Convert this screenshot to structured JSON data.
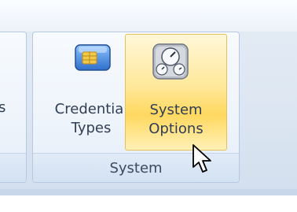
{
  "ribbon": {
    "left_group": {
      "partial_label": "s"
    },
    "system_group": {
      "label": "System",
      "buttons": [
        {
          "line1": "Credential",
          "line2": "Types",
          "icon": "credential-card-icon"
        },
        {
          "line1": "System",
          "line2": "Options",
          "icon": "gauges-icon",
          "state": "hover"
        }
      ]
    }
  },
  "cursor": {
    "icon": "mouse-pointer-icon"
  }
}
